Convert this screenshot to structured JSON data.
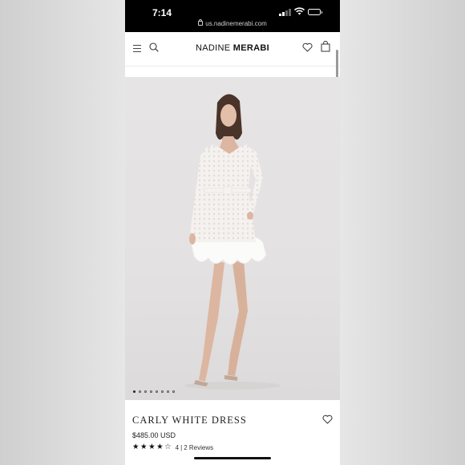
{
  "status_bar": {
    "time": "7:14",
    "url": "us.nadinemerabi.com",
    "icons": [
      "signal-icon",
      "wifi-icon",
      "battery-icon"
    ]
  },
  "header": {
    "brand_light": "NADINE",
    "brand_bold": "MERABI",
    "icons": [
      "hamburger-menu-icon",
      "search-icon",
      "heart-icon",
      "shopping-bag-icon"
    ]
  },
  "gallery": {
    "image_count": 8,
    "active_index": 0
  },
  "product": {
    "name": "CARLY WHITE DRESS",
    "price": "$485.00 USD",
    "rating": 4,
    "rating_max": 5,
    "rating_value_text": "4",
    "separator": "|",
    "reviews_text": "2 Reviews"
  },
  "colors": {
    "status_bar_bg": "#000000",
    "page_bg": "#ffffff",
    "image_bg": "#e4e2e2",
    "text": "#222222"
  }
}
